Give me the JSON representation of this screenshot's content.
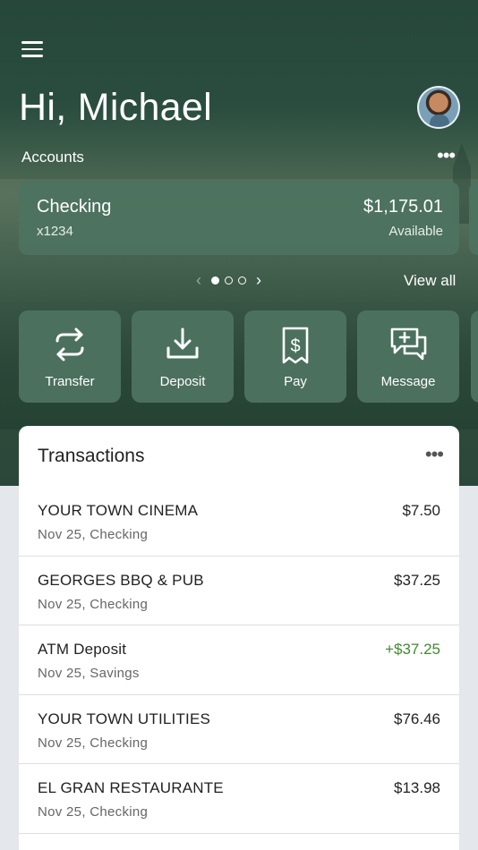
{
  "header": {
    "greeting": "Hi, Michael",
    "accounts_label": "Accounts",
    "more_glyph": "•••"
  },
  "account": {
    "name": "Checking",
    "number": "x1234",
    "balance": "$1,175.01",
    "balance_label": "Available"
  },
  "pager": {
    "prev": "‹",
    "next": "›",
    "view_all": "View all",
    "pages": 3,
    "active_page": 1
  },
  "actions": [
    {
      "label": "Transfer",
      "icon": "transfer-icon"
    },
    {
      "label": "Deposit",
      "icon": "deposit-icon"
    },
    {
      "label": "Pay",
      "icon": "pay-icon"
    },
    {
      "label": "Message",
      "icon": "message-icon"
    }
  ],
  "transactions": {
    "title": "Transactions",
    "more_glyph": "•••",
    "items": [
      {
        "name": "YOUR TOWN CINEMA",
        "sub": "Nov 25, Checking",
        "amount": "$7.50",
        "positive": false
      },
      {
        "name": "GEORGES BBQ & PUB",
        "sub": "Nov 25, Checking",
        "amount": "$37.25",
        "positive": false
      },
      {
        "name": "ATM Deposit",
        "sub": "Nov 25, Savings",
        "amount": "+$37.25",
        "positive": true
      },
      {
        "name": "YOUR TOWN UTILITIES",
        "sub": "Nov 25, Checking",
        "amount": "$76.46",
        "positive": false
      },
      {
        "name": "EL GRAN RESTAURANTE",
        "sub": "Nov 25, Checking",
        "amount": "$13.98",
        "positive": false
      }
    ]
  },
  "colors": {
    "positive_amount": "#3f8a2f",
    "card_green": "#4d7360",
    "hero_green": "#2a4d3f"
  }
}
